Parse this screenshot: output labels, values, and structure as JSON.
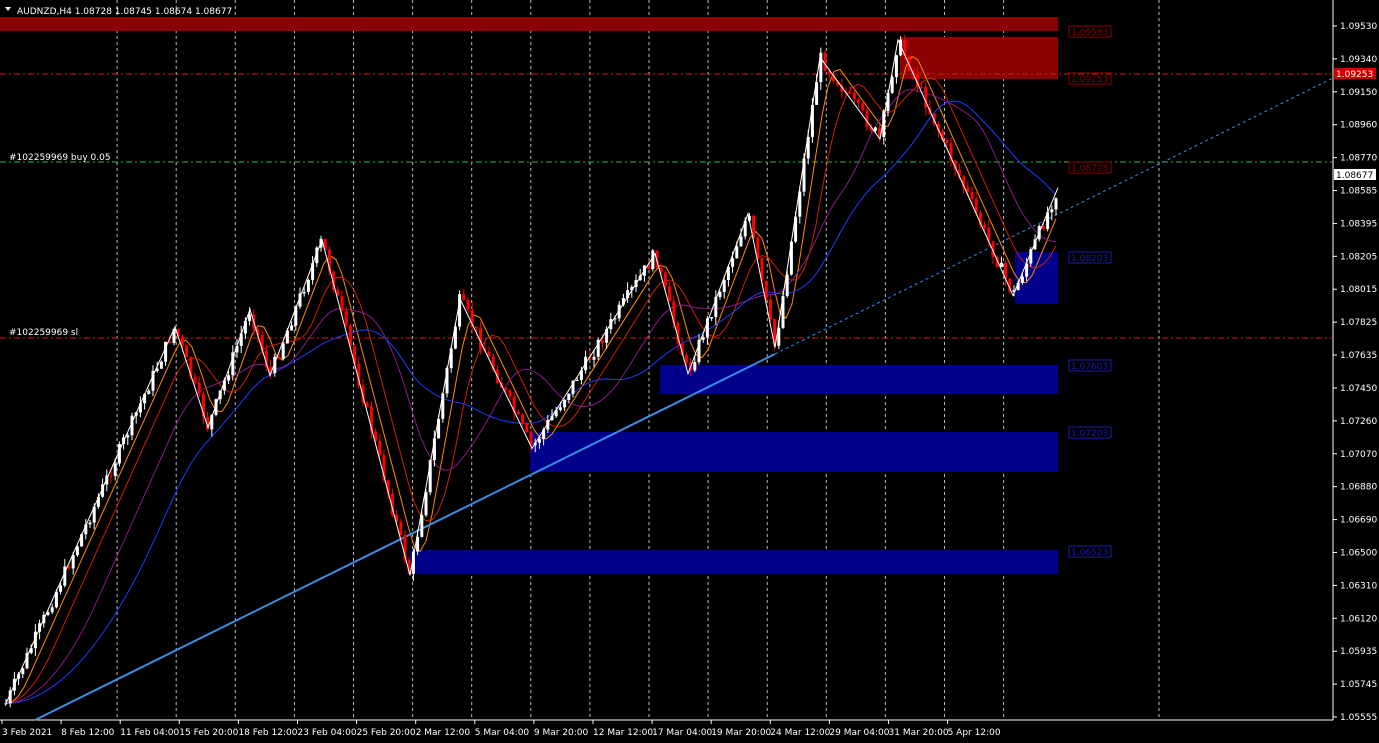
{
  "header": {
    "menu_arrow": "triangle-down-icon",
    "symbol_info": "AUDNZD,H4  1.08728 1.08745 1.08674 1.08677"
  },
  "order_labels": {
    "buy": "#102259969 buy 0.05",
    "sl": "#102259969 sl"
  },
  "price_axis": {
    "ticks": [
      "1.09530",
      "1.09340",
      "1.09150",
      "1.08960",
      "1.08770",
      "1.08585",
      "1.08395",
      "1.08205",
      "1.08015",
      "1.07825",
      "1.07635",
      "1.07450",
      "1.07260",
      "1.07070",
      "1.06880",
      "1.06690",
      "1.06500",
      "1.06310",
      "1.06120",
      "1.05935",
      "1.05745",
      "1.05555"
    ],
    "current_price": "1.08677",
    "sl_price": "1.09253"
  },
  "time_axis": {
    "ticks": [
      "3 Feb 2021",
      "8 Feb 12:00",
      "11 Feb 04:00",
      "15 Feb 20:00",
      "18 Feb 12:00",
      "23 Feb 04:00",
      "25 Feb 20:00",
      "2 Mar 12:00",
      "5 Mar 04:00",
      "9 Mar 20:00",
      "12 Mar 12:00",
      "17 Mar 04:00",
      "19 Mar 20:00",
      "24 Mar 12:00",
      "29 Mar 04:00",
      "31 Mar 20:00",
      "5 Apr 12:00"
    ]
  },
  "zone_labels": [
    "1.09583",
    "1.09253",
    "1.08728",
    "1.08203",
    "1.07603",
    "1.07203",
    "1.06523"
  ],
  "colors": {
    "background": "#000000",
    "bull_candle": "#ffffff",
    "bear_candle": "#ff0000",
    "supply_zone": "#8b0000",
    "demand_zone": "#00008b",
    "trendline": "#3a8ee6",
    "buy_line": "#3cb043",
    "sl_line": "#cc2200",
    "zigzag": "#ffffff"
  },
  "chart_data": {
    "type": "candlestick",
    "symbol": "AUDNZD",
    "timeframe": "H4",
    "ohlc_current": {
      "open": 1.08728,
      "high": 1.08745,
      "low": 1.08674,
      "close": 1.08677
    },
    "ylim": [
      1.05555,
      1.0965
    ],
    "zigzag": [
      {
        "t": "3 Feb 2021",
        "p": 1.0562
      },
      {
        "t": "11 Feb 04:00",
        "p": 1.078
      },
      {
        "t": "15 Feb 20:00",
        "p": 1.0722
      },
      {
        "t": "17 Feb",
        "p": 1.079
      },
      {
        "t": "18 Feb 12:00",
        "p": 1.0752
      },
      {
        "t": "23 Feb",
        "p": 1.083
      },
      {
        "t": "26 Feb",
        "p": 1.0637
      },
      {
        "t": "2 Mar",
        "p": 1.0796
      },
      {
        "t": "5 Mar 04:00",
        "p": 1.071
      },
      {
        "t": "11 Mar",
        "p": 1.0822
      },
      {
        "t": "15 Mar",
        "p": 1.0753
      },
      {
        "t": "18 Mar",
        "p": 1.0845
      },
      {
        "t": "19 Mar",
        "p": 1.0768
      },
      {
        "t": "23 Mar",
        "p": 1.0935
      },
      {
        "t": "26 Mar",
        "p": 1.0888
      },
      {
        "t": "29 Mar",
        "p": 1.0945
      },
      {
        "t": "31 Mar 20:00",
        "p": 1.0798
      },
      {
        "t": "5 Apr",
        "p": 1.086
      }
    ]
  }
}
